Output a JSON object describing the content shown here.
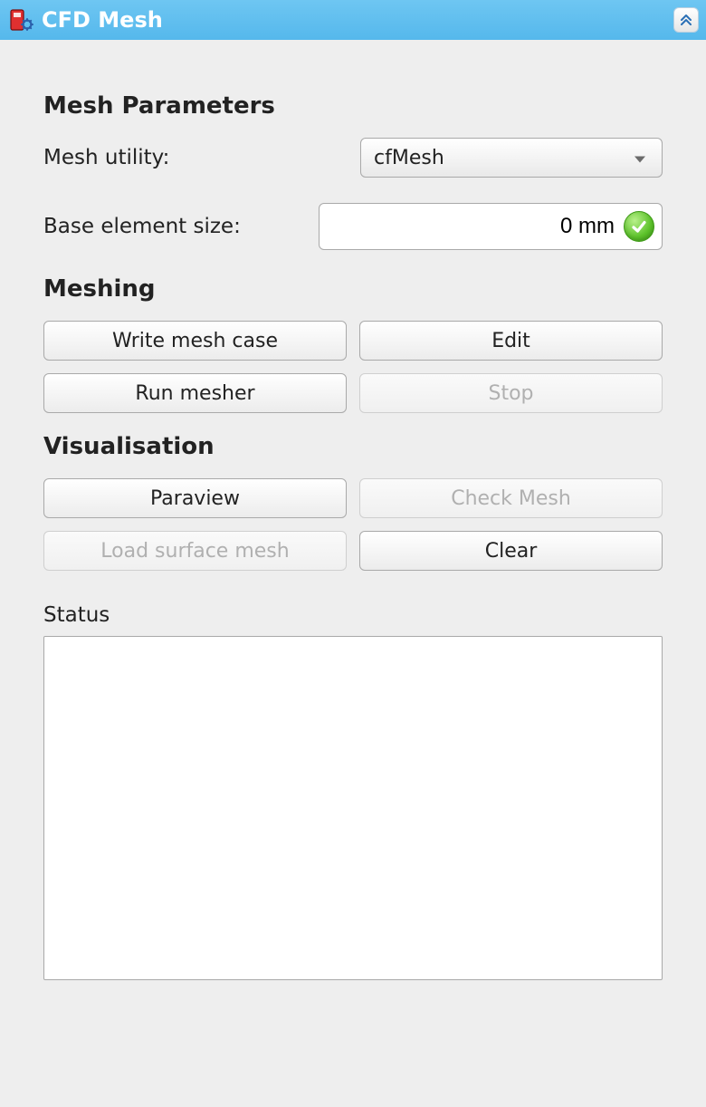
{
  "titlebar": {
    "title": "CFD Mesh"
  },
  "sections": {
    "params": {
      "heading": "Mesh Parameters",
      "mesh_utility_label": "Mesh utility:",
      "mesh_utility_value": "cfMesh",
      "base_size_label": "Base element size:",
      "base_size_value": "0 mm"
    },
    "meshing": {
      "heading": "Meshing",
      "write": "Write mesh case",
      "edit": "Edit",
      "run": "Run mesher",
      "stop": "Stop"
    },
    "visualisation": {
      "heading": "Visualisation",
      "paraview": "Paraview",
      "check": "Check Mesh",
      "load": "Load surface mesh",
      "clear": "Clear"
    },
    "status": {
      "label": "Status",
      "text": ""
    }
  }
}
